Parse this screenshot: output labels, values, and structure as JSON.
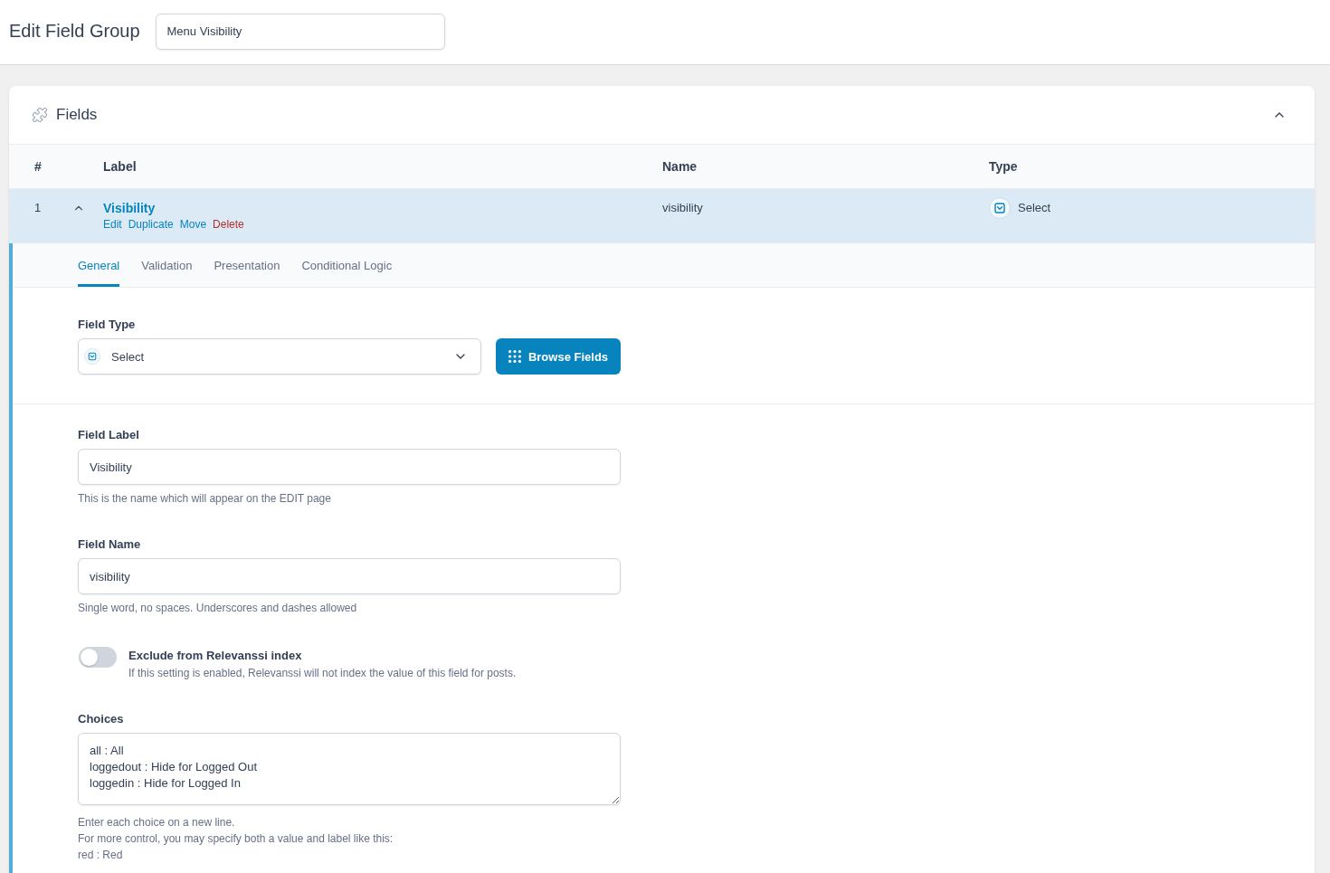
{
  "header": {
    "title": "Edit Field Group",
    "title_field": {
      "value": "Menu Visibility"
    }
  },
  "fields_panel": {
    "title": "Fields",
    "expanded": true,
    "table": {
      "columns": [
        "#",
        "Label",
        "Name",
        "Type"
      ],
      "rows": [
        {
          "number": "1",
          "label": "Visibility",
          "expanded": true,
          "actions": [
            {
              "label": "Edit",
              "kind": "link"
            },
            {
              "label": "Duplicate",
              "kind": "link"
            },
            {
              "label": "Move",
              "kind": "link"
            },
            {
              "label": "Delete",
              "kind": "danger"
            }
          ],
          "name": "visibility",
          "type": "Select",
          "settings": {
            "tabs": [
              {
                "label": "General",
                "selected": true
              },
              {
                "label": "Validation",
                "selected": false
              },
              {
                "label": "Presentation",
                "selected": false
              },
              {
                "label": "Conditional Logic",
                "selected": false
              }
            ],
            "field_type": {
              "label": "Field Type",
              "value": "Select",
              "browse_button": "Browse Fields"
            },
            "fields": [
              {
                "kind": "text",
                "label": "Field Label",
                "value": "Visibility",
                "help": [
                  "This is the name which will appear on the EDIT page"
                ]
              },
              {
                "kind": "text",
                "label": "Field Name",
                "value": "visibility",
                "help": [
                  "Single word, no spaces. Underscores and dashes allowed"
                ]
              },
              {
                "kind": "toggle",
                "label": "Exclude from Relevanssi index",
                "on": false,
                "description": "If this setting is enabled, Relevanssi will not index the value of this field for posts."
              },
              {
                "kind": "textarea",
                "label": "Choices",
                "value": "all : All\nloggedout : Hide for Logged Out\nloggedin : Hide for Logged In",
                "help": [
                  "Enter each choice on a new line.",
                  "For more control, you may specify both a value and label like this:",
                  "red : Red"
                ]
              }
            ]
          }
        }
      ]
    }
  }
}
